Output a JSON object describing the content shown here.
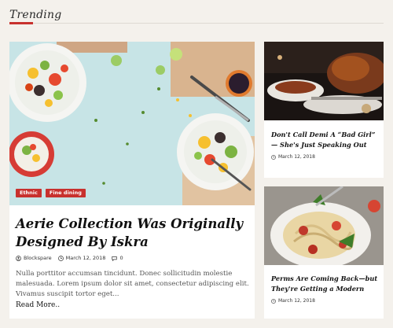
{
  "section": {
    "title": "Trending"
  },
  "main_post": {
    "tags": [
      "Ethnic",
      "Fine dining"
    ],
    "title": "Aerie Collection Was Originally Designed By Iskra",
    "author": "Blockspare",
    "date": "March 12, 2018",
    "comments": "0",
    "excerpt": "Nulla porttitor accumsan tincidunt. Donec sollicitudin molestie malesuada. Lorem ipsum dolor sit amet, consectetur adipiscing elit. Vivamus suscipit tortor eget...",
    "read_more": "Read More.."
  },
  "side_posts": [
    {
      "title": "Don't Call Demi A “Bad Girl” — She's Just Speaking Out",
      "date": "March 12, 2018"
    },
    {
      "title": "Perms Are Coming Back—but They're Getting a Modern",
      "date": "March 12, 2018"
    }
  ],
  "colors": {
    "accent": "#c8312e",
    "background": "#f4f1ec"
  },
  "icons": {
    "author": "user-icon",
    "date": "clock-icon",
    "comments": "comment-icon"
  }
}
